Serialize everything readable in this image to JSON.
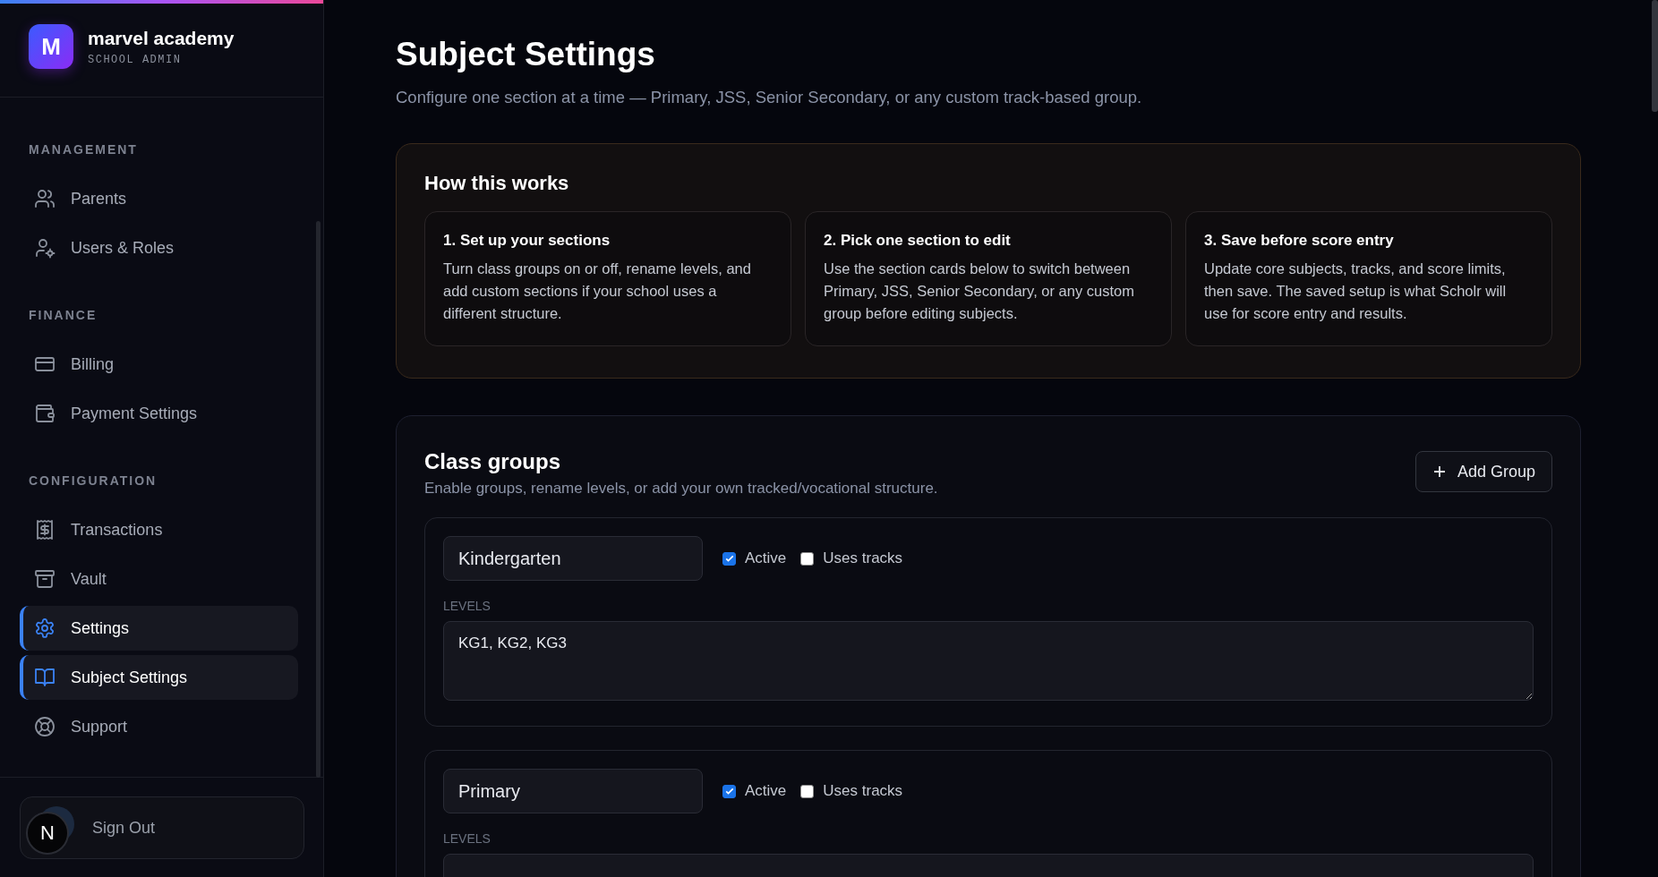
{
  "brand": {
    "logo_letter": "M",
    "name": "marvel academy",
    "subtitle": "SCHOOL ADMIN"
  },
  "sidebar": {
    "sections": [
      {
        "title": "MANAGEMENT",
        "items": [
          {
            "label": "Parents",
            "selected": false
          },
          {
            "label": "Users & Roles",
            "selected": false
          }
        ]
      },
      {
        "title": "FINANCE",
        "items": [
          {
            "label": "Billing",
            "selected": false
          },
          {
            "label": "Payment Settings",
            "selected": false
          }
        ]
      },
      {
        "title": "CONFIGURATION",
        "items": [
          {
            "label": "Transactions",
            "selected": false
          },
          {
            "label": "Vault",
            "selected": false
          },
          {
            "label": "Settings",
            "selected": true
          },
          {
            "label": "Subject Settings",
            "selected": true
          },
          {
            "label": "Support",
            "selected": false
          }
        ]
      }
    ]
  },
  "sign_out": {
    "avatar_letter": "N",
    "label": "Sign Out"
  },
  "page": {
    "title": "Subject Settings",
    "subtitle": "Configure one section at a time — Primary, JSS, Senior Secondary, or any custom track-based group."
  },
  "how_it_works": {
    "title": "How this works",
    "steps": [
      {
        "title": "1. Set up your sections",
        "text": "Turn class groups on or off, rename levels, and add custom sections if your school uses a different structure."
      },
      {
        "title": "2. Pick one section to edit",
        "text": "Use the section cards below to switch between Primary, JSS, Senior Secondary, or any custom group before editing subjects."
      },
      {
        "title": "3. Save before score entry",
        "text": "Update core subjects, tracks, and score limits, then save. The saved setup is what Scholr will use for score entry and results."
      }
    ]
  },
  "class_groups": {
    "title": "Class groups",
    "subtitle": "Enable groups, rename levels, or add your own tracked/vocational structure.",
    "add_button": "Add Group",
    "groups": [
      {
        "name": "Kindergarten",
        "active": true,
        "active_label": "Active",
        "uses_tracks": false,
        "tracks_label": "Uses tracks",
        "levels_label": "LEVELS",
        "levels": "KG1, KG2, KG3"
      },
      {
        "name": "Primary",
        "active": true,
        "active_label": "Active",
        "uses_tracks": false,
        "tracks_label": "Uses tracks",
        "levels_label": "LEVELS"
      }
    ]
  }
}
